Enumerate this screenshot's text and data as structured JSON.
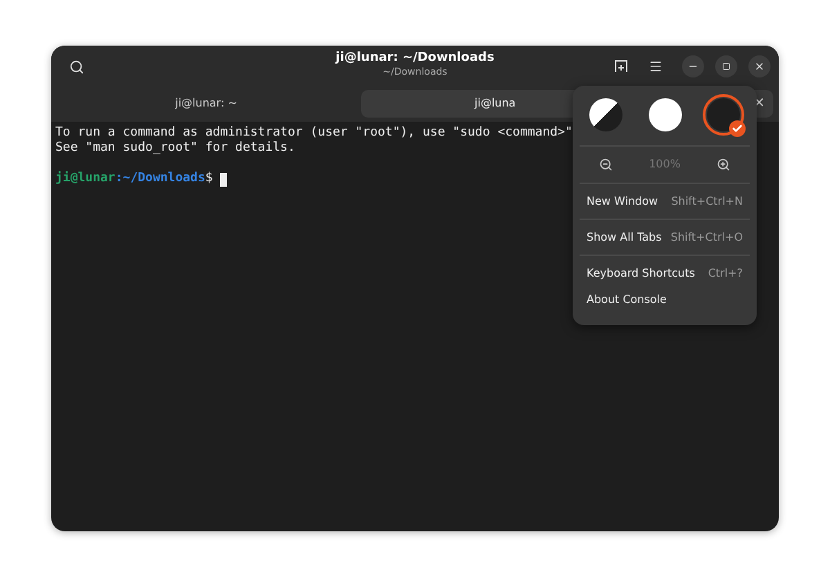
{
  "window": {
    "title": "ji@lunar: ~/Downloads",
    "subtitle": "~/Downloads"
  },
  "tabs": [
    {
      "label": "ji@lunar: ~",
      "selected": false
    },
    {
      "label": "ji@luna",
      "selected": true,
      "close": "×"
    }
  ],
  "terminal": {
    "lines": [
      "To run a command as administrator (user \"root\"), use \"sudo <command>\"",
      "See \"man sudo_root\" for details."
    ],
    "prompt": {
      "user": "ji@lunar",
      "path": ":~/Downloads",
      "symbol": "$"
    }
  },
  "menu": {
    "themes": [
      {
        "kind": "system",
        "selected": false
      },
      {
        "kind": "light",
        "selected": false
      },
      {
        "kind": "dark",
        "selected": true
      }
    ],
    "zoom": {
      "level_text": "100%",
      "disabled": true
    },
    "sections": [
      [
        {
          "label": "New Window",
          "shortcut": "Shift+Ctrl+N"
        }
      ],
      [
        {
          "label": "Show All Tabs",
          "shortcut": "Shift+Ctrl+O"
        }
      ],
      [
        {
          "label": "Keyboard Shortcuts",
          "shortcut": "Ctrl+?"
        },
        {
          "label": "About Console"
        }
      ]
    ]
  }
}
